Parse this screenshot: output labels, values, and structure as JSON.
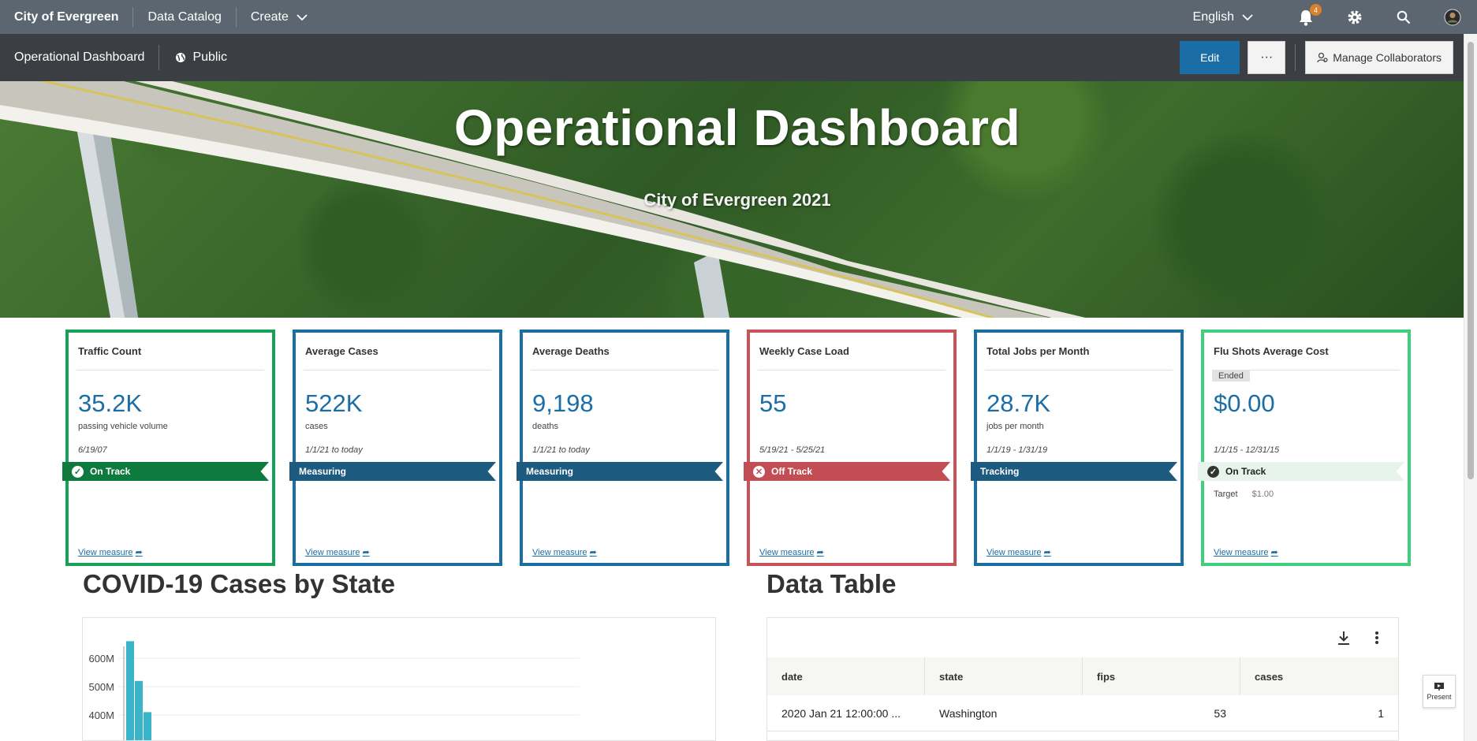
{
  "topnav": {
    "brand": "City of Evergreen",
    "links": [
      "Data Catalog",
      "Create"
    ],
    "language": "English",
    "notification_count": "4"
  },
  "subbar": {
    "title": "Operational Dashboard",
    "visibility": "Public",
    "edit_label": "Edit",
    "more_label": "···",
    "collaborators_label": "Manage Collaborators"
  },
  "hero": {
    "title": "Operational Dashboard",
    "subtitle": "City of Evergreen 2021"
  },
  "cards": [
    {
      "title": "Traffic Count",
      "value": "35.2K",
      "unit": "passing vehicle volume",
      "period": "6/19/07",
      "status": "On Track",
      "status_icon": "check-icon",
      "color": "#16a15a",
      "ribbon_color": "#0f7a3e",
      "link": "View measure"
    },
    {
      "title": "Average Cases",
      "value": "522K",
      "unit": "cases",
      "period": "1/1/21 to today",
      "status": "Measuring",
      "color": "#1b6ea5",
      "ribbon_color": "#1d5a80",
      "link": "View measure"
    },
    {
      "title": "Average Deaths",
      "value": "9,198",
      "unit": "deaths",
      "period": "1/1/21 to today",
      "status": "Measuring",
      "color": "#1b6ea5",
      "ribbon_color": "#1d5a80",
      "link": "View measure"
    },
    {
      "title": "Weekly Case Load",
      "value": "55",
      "unit": "",
      "period": "5/19/21 - 5/25/21",
      "status": "Off Track",
      "status_icon": "x-icon",
      "color": "#c9535a",
      "ribbon_color": "#c24e54",
      "link": "View measure"
    },
    {
      "title": "Total Jobs per Month",
      "value": "28.7K",
      "unit": "jobs per month",
      "period": "1/1/19 - 1/31/19",
      "status": "Tracking",
      "color": "#1b6ea5",
      "ribbon_color": "#1d5a80",
      "link": "View measure"
    },
    {
      "title": "Flu Shots Average Cost",
      "badge": "Ended",
      "value": "$0.00",
      "unit": "",
      "period": "1/1/15 - 12/31/15",
      "status": "On Track",
      "status_icon": "check-icon",
      "color": "#3fcf7f",
      "ribbon_color": "#e6f4ec",
      "target_label": "Target",
      "target_value": "$1.00",
      "link": "View measure"
    }
  ],
  "sections": {
    "chart_title": "COVID-19 Cases by State",
    "table_title": "Data Table"
  },
  "chart_data": {
    "type": "bar",
    "title": "COVID-19 Cases by State",
    "y_tick_labels": [
      "600M",
      "500M",
      "400M"
    ],
    "y_ticks": [
      600,
      500,
      400
    ],
    "ylabel_units": "M",
    "values": [
      660,
      520,
      410
    ],
    "color": "#3ab4c8"
  },
  "table": {
    "columns": [
      "date",
      "state",
      "fips",
      "cases"
    ],
    "rows": [
      {
        "date": "2020 Jan 21 12:00:00 ...",
        "state": "Washington",
        "fips": "53",
        "cases": "1"
      }
    ]
  },
  "present_label": "Present"
}
